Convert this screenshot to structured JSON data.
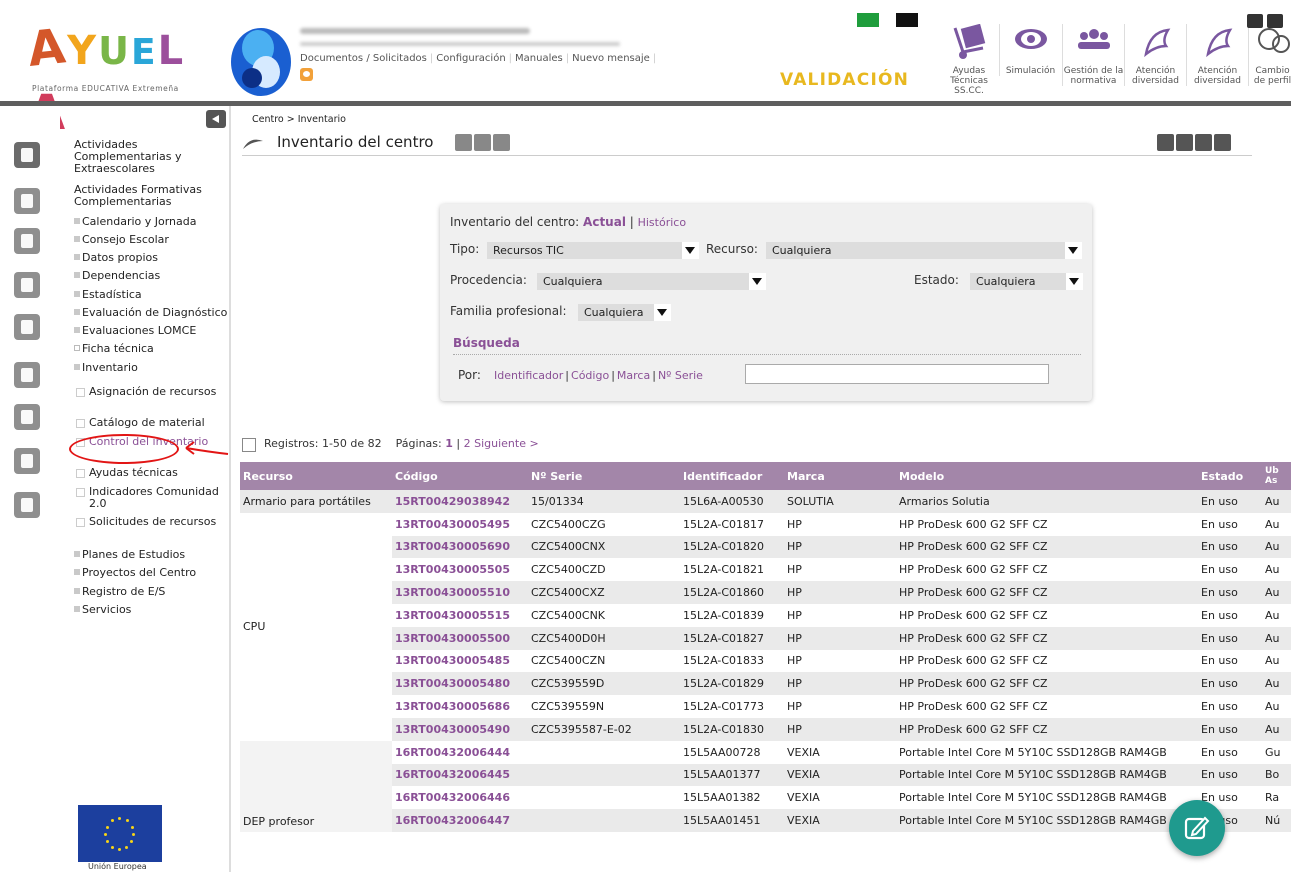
{
  "header": {
    "logo_text": "AYUELA",
    "logo_subtitle": "Plataforma EDUCATIVA Extremeña",
    "top_links": [
      "Documentos / Solicitados",
      "Configuración",
      "Manuales",
      "Nuevo mensaje"
    ],
    "validacion": "VALIDACIÓN",
    "tools": [
      {
        "label": "Ayudas Técnicas SS.CC."
      },
      {
        "label": "Simulación"
      },
      {
        "label": "Gestión de la normativa"
      },
      {
        "label": "Atención diversidad"
      },
      {
        "label": "Atención diversidad"
      },
      {
        "label": "Cambio de perfil"
      }
    ]
  },
  "sidebar": {
    "items": [
      {
        "label": "Actividades Complementarias y Extraescolares"
      },
      {
        "label": "Actividades Formativas Complementarias"
      },
      {
        "label": "Calendario y Jornada"
      },
      {
        "label": "Consejo Escolar"
      },
      {
        "label": "Datos propios"
      },
      {
        "label": "Dependencias"
      },
      {
        "label": "Estadística"
      },
      {
        "label": "Evaluación de Diagnóstico"
      },
      {
        "label": "Evaluaciones LOMCE"
      },
      {
        "label": "Ficha técnica"
      },
      {
        "label": "Inventario"
      },
      {
        "label": "Planes de Estudios"
      },
      {
        "label": "Proyectos del Centro"
      },
      {
        "label": "Registro de E/S"
      },
      {
        "label": "Servicios"
      }
    ],
    "subitems": [
      {
        "label": "Asignación de recursos"
      },
      {
        "label": "Catálogo de material"
      },
      {
        "label": "Control del inventario"
      },
      {
        "label": "Ayudas técnicas"
      },
      {
        "label": "Indicadores Comunidad 2.0"
      },
      {
        "label": "Solicitudes de recursos"
      }
    ],
    "eu_label": "Unión Europea"
  },
  "main": {
    "breadcrumb": "Centro > Inventario",
    "title": "Inventario del centro"
  },
  "filter": {
    "inventario_label": "Inventario del centro:",
    "actual": "Actual",
    "historico": "Histórico",
    "tipo_label": "Tipo:",
    "tipo_value": "Recursos TIC",
    "recurso_label": "Recurso:",
    "recurso_value": "Cualquiera",
    "procedencia_label": "Procedencia:",
    "procedencia_value": "Cualquiera",
    "estado_label": "Estado:",
    "estado_value": "Cualquiera",
    "familia_label": "Familia profesional:",
    "familia_value": "Cualquiera",
    "busqueda": "Búsqueda",
    "por_label": "Por:",
    "por_links": [
      "Identificador",
      "Código",
      "Marca",
      "Nº Serie"
    ]
  },
  "pagination": {
    "registros": "Registros: 1-50 de 82",
    "paginas_label": "Páginas:",
    "page_current": "1",
    "page_next": "2",
    "siguiente": "Siguiente >"
  },
  "table": {
    "headers": [
      "Recurso",
      "Código",
      "Nº Serie",
      "Identificador",
      "Marca",
      "Modelo",
      "Estado",
      "Ub As"
    ],
    "groups": {
      "armario": "Armario para portátiles",
      "cpu": "CPU",
      "dep": "DEP profesor"
    },
    "rows": [
      {
        "codigo": "15RT00429038942",
        "serie": "15/01334",
        "ident": "15L6A-A00530",
        "marca": "SOLUTIA",
        "modelo": "Armarios Solutia",
        "estado": "En uso",
        "ub": "Au"
      },
      {
        "codigo": "13RT00430005495",
        "serie": "CZC5400CZG",
        "ident": "15L2A-C01817",
        "marca": "HP",
        "modelo": "HP ProDesk 600 G2 SFF CZ",
        "estado": "En uso",
        "ub": "Au"
      },
      {
        "codigo": "13RT00430005690",
        "serie": "CZC5400CNX",
        "ident": "15L2A-C01820",
        "marca": "HP",
        "modelo": "HP ProDesk 600 G2 SFF CZ",
        "estado": "En uso",
        "ub": "Au"
      },
      {
        "codigo": "13RT00430005505",
        "serie": "CZC5400CZD",
        "ident": "15L2A-C01821",
        "marca": "HP",
        "modelo": "HP ProDesk 600 G2 SFF CZ",
        "estado": "En uso",
        "ub": "Au"
      },
      {
        "codigo": "13RT00430005510",
        "serie": "CZC5400CXZ",
        "ident": "15L2A-C01860",
        "marca": "HP",
        "modelo": "HP ProDesk 600 G2 SFF CZ",
        "estado": "En uso",
        "ub": "Au"
      },
      {
        "codigo": "13RT00430005515",
        "serie": "CZC5400CNK",
        "ident": "15L2A-C01839",
        "marca": "HP",
        "modelo": "HP ProDesk 600 G2 SFF CZ",
        "estado": "En uso",
        "ub": "Au"
      },
      {
        "codigo": "13RT00430005500",
        "serie": "CZC5400D0H",
        "ident": "15L2A-C01827",
        "marca": "HP",
        "modelo": "HP ProDesk 600 G2 SFF CZ",
        "estado": "En uso",
        "ub": "Au"
      },
      {
        "codigo": "13RT00430005485",
        "serie": "CZC5400CZN",
        "ident": "15L2A-C01833",
        "marca": "HP",
        "modelo": "HP ProDesk 600 G2 SFF CZ",
        "estado": "En uso",
        "ub": "Au"
      },
      {
        "codigo": "13RT00430005480",
        "serie": "CZC539559D",
        "ident": "15L2A-C01829",
        "marca": "HP",
        "modelo": "HP ProDesk 600 G2 SFF CZ",
        "estado": "En uso",
        "ub": "Au"
      },
      {
        "codigo": "13RT00430005686",
        "serie": "CZC539559N",
        "ident": "15L2A-C01773",
        "marca": "HP",
        "modelo": "HP ProDesk 600 G2 SFF CZ",
        "estado": "En uso",
        "ub": "Au"
      },
      {
        "codigo": "13RT00430005490",
        "serie": "CZC5395587-E-02",
        "ident": "15L2A-C01830",
        "marca": "HP",
        "modelo": "HP ProDesk 600 G2 SFF CZ",
        "estado": "En uso",
        "ub": "Au"
      },
      {
        "codigo": "16RT00432006444",
        "serie": "",
        "ident": "15L5AA00728",
        "marca": "VEXIA",
        "modelo": "Portable Intel Core M 5Y10C SSD128GB RAM4GB",
        "estado": "En uso",
        "ub": "Gu"
      },
      {
        "codigo": "16RT00432006445",
        "serie": "",
        "ident": "15L5AA01377",
        "marca": "VEXIA",
        "modelo": "Portable Intel Core M 5Y10C SSD128GB RAM4GB",
        "estado": "En uso",
        "ub": "Bo"
      },
      {
        "codigo": "16RT00432006446",
        "serie": "",
        "ident": "15L5AA01382",
        "marca": "VEXIA",
        "modelo": "Portable Intel Core M 5Y10C SSD128GB RAM4GB",
        "estado": "En uso",
        "ub": "Ra"
      },
      {
        "codigo": "16RT00432006447",
        "serie": "",
        "ident": "15L5AA01451",
        "marca": "VEXIA",
        "modelo": "Portable Intel Core M 5Y10C SSD128GB RAM4GB",
        "estado": "En uso",
        "ub": "Nú"
      }
    ]
  }
}
